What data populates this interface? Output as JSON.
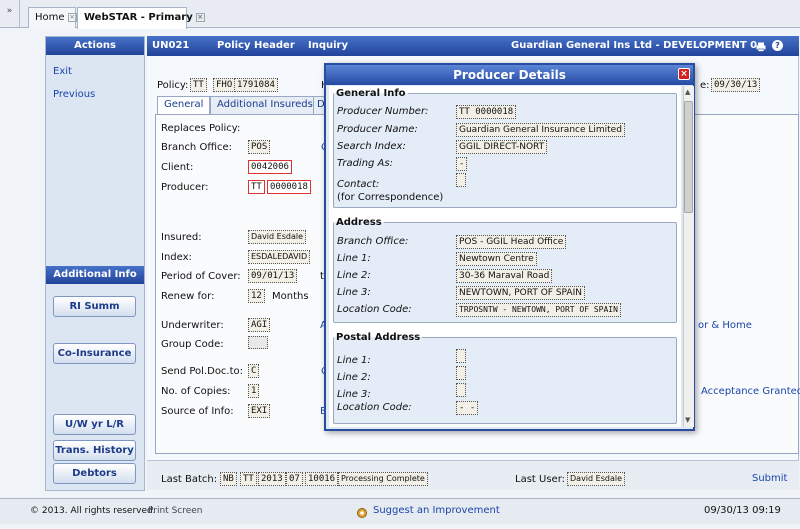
{
  "tabs": {
    "collapse": "»",
    "home": "Home",
    "primary": "WebSTAR - Primary",
    "close": "×"
  },
  "sidebar": {
    "actions_title": "Actions",
    "exit": "Exit",
    "previous": "Previous",
    "additional_title": "Additional Info",
    "buttons": [
      "RI Summ",
      "Co-Insurance",
      "U/W yr L/R",
      "Trans. History",
      "Debtors"
    ]
  },
  "header": {
    "code": "UN021",
    "title": "Policy Header",
    "mode": "Inquiry",
    "company": "Guardian General Ins Ltd - DEVELOPMENT 0",
    "print_icon": "printer-icon",
    "help_icon": "help-icon"
  },
  "policy": {
    "label": "Policy:",
    "prefix": "TT",
    "type": "FHO",
    "number": "1791084",
    "h_label": "H",
    "date_suffix": "e:",
    "date": "09/30/13"
  },
  "form_tabs": [
    "General",
    "Additional Insureds",
    "D"
  ],
  "fields": {
    "replaces": "Replaces Policy:",
    "branch_label": "Branch Office:",
    "branch": "POS",
    "client_label": "Client:",
    "client": "0042006",
    "producer_label": "Producer:",
    "producer_prefix": "TT",
    "producer": "0000018",
    "insured_label": "Insured:",
    "insured": "David Esdale",
    "index_label": "Index:",
    "index": "ESDALEDAVID",
    "period_label": "Period of Cover:",
    "period": "09/01/13",
    "period_t": "t",
    "renew_label": "Renew for:",
    "renew": "12",
    "renew_unit": "Months",
    "uw_label": "Underwriter:",
    "uw": "AGI",
    "uw_blue": "A",
    "group_label": "Group Code:",
    "send_label": "Send Pol.Doc.to:",
    "send": "C",
    "send_blue": "C",
    "copies_label": "No. of Copies:",
    "copies": "1",
    "source_label": "Source of Info:",
    "source": "EXI",
    "source_blue": "E",
    "branch_blue": "C",
    "right_link1": "or & Home",
    "right_link2": "Acceptance Granted"
  },
  "bottom": {
    "batch_label": "Last Batch:",
    "batch_a": "NB",
    "batch_b": "TT",
    "batch_c": "2013",
    "batch_d": "07",
    "batch_e": "10016",
    "batch_status": "Processing Complete",
    "user_label": "Last User:",
    "user": "David Esdale",
    "submit": "Submit"
  },
  "footer": {
    "copyright": "© 2013. All rights reserved.",
    "print": "Print Screen",
    "suggest": "Suggest an Improvement",
    "datetime": "09/30/13  09:19"
  },
  "modal": {
    "title": "Producer Details",
    "close": "×",
    "general": {
      "legend": "General Info",
      "number_label": "Producer Number:",
      "number": "TT 0000018",
      "name_label": "Producer Name:",
      "name": "Guardian General Insurance Limited",
      "search_label": "Search Index:",
      "search": "GGIL DIRECT-NORT",
      "trading_label": "Trading As:",
      "trading": "-",
      "contact_label": "Contact:",
      "contact": "",
      "corr_label": "(for Correspondence)"
    },
    "address": {
      "legend": "Address",
      "branch_label": "Branch Office:",
      "branch": "POS - GGIL Head Office",
      "l1_label": "Line 1:",
      "l1": "Newtown Centre",
      "l2_label": "Line 2:",
      "l2": "30-36 Maraval Road",
      "l3_label": "Line 3:",
      "l3": "NEWTOWN, PORT OF SPAIN",
      "loc_label": "Location Code:",
      "loc": "TRPOSNTW - NEWTOWN, PORT OF SPAIN"
    },
    "postal": {
      "legend": "Postal Address",
      "l1_label": "Line 1:",
      "l2_label": "Line 2:",
      "l3_label": "Line 3:",
      "loc_label": "Location Code:",
      "loc": "- -"
    }
  },
  "colors": {
    "header_blue": "#22439a",
    "link_blue": "#1a46a8",
    "close_red": "#d62020"
  }
}
